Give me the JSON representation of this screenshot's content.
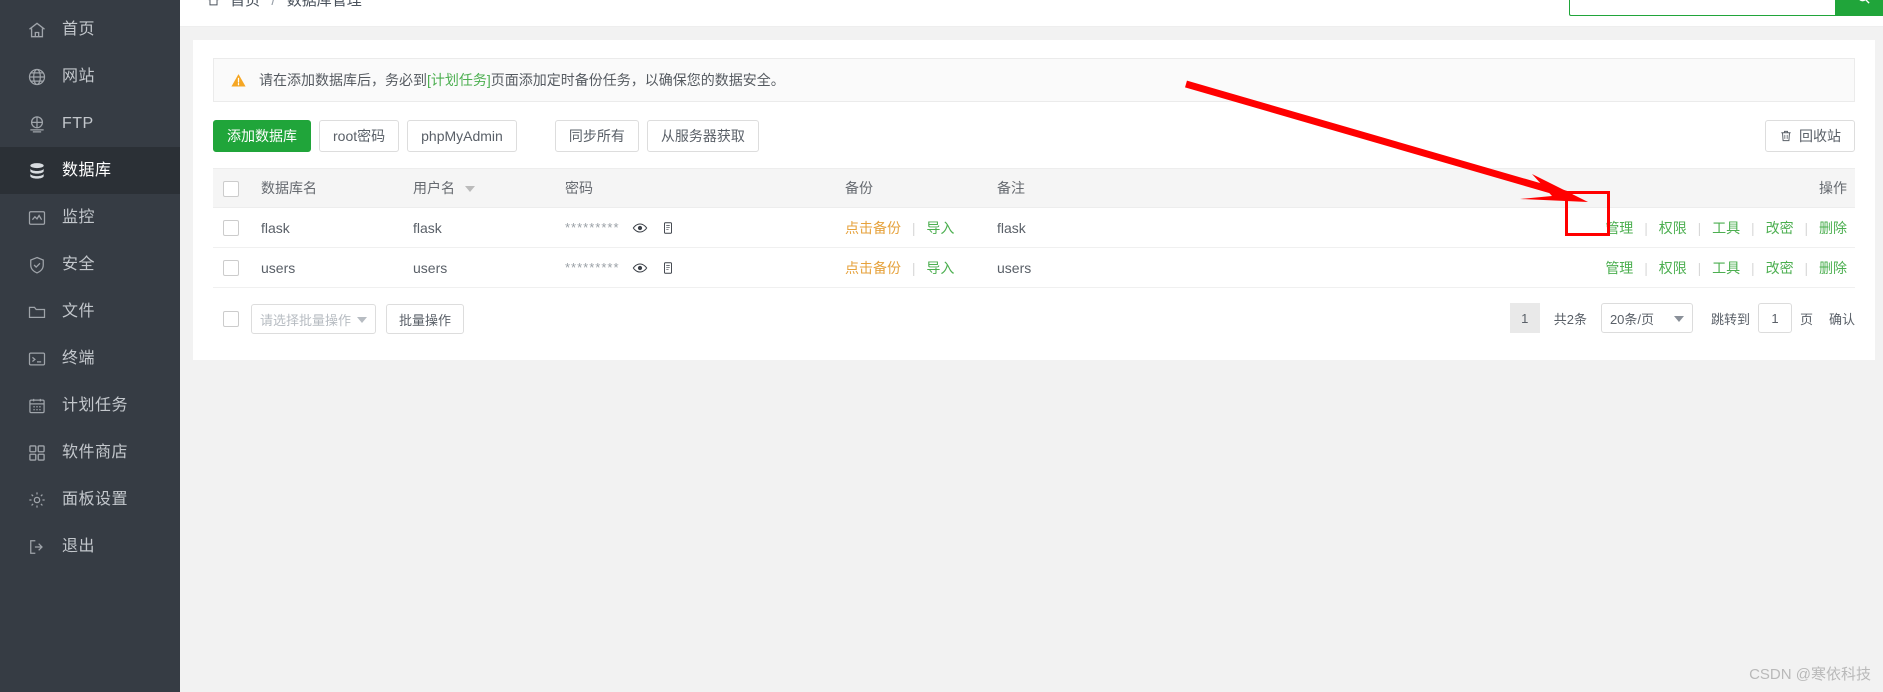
{
  "sidebar": {
    "items": [
      {
        "label": "首页",
        "icon": "home-icon",
        "active": false
      },
      {
        "label": "网站",
        "icon": "globe-icon",
        "active": false
      },
      {
        "label": "FTP",
        "icon": "ftp-icon",
        "active": false
      },
      {
        "label": "数据库",
        "icon": "database-icon",
        "active": true
      },
      {
        "label": "监控",
        "icon": "monitor-icon",
        "active": false
      },
      {
        "label": "安全",
        "icon": "shield-icon",
        "active": false
      },
      {
        "label": "文件",
        "icon": "folder-icon",
        "active": false
      },
      {
        "label": "终端",
        "icon": "terminal-icon",
        "active": false
      },
      {
        "label": "计划任务",
        "icon": "calendar-icon",
        "active": false
      },
      {
        "label": "软件商店",
        "icon": "apps-icon",
        "active": false
      },
      {
        "label": "面板设置",
        "icon": "gear-icon",
        "active": false
      },
      {
        "label": "退出",
        "icon": "logout-icon",
        "active": false
      }
    ]
  },
  "topbar": {
    "breadcrumb_home": "首页",
    "breadcrumb_sep": "/",
    "breadcrumb_current": "数据库管理",
    "search_value": "",
    "search_placeholder": "",
    "search_button_icon": "search-icon"
  },
  "notice": {
    "icon": "warning-icon",
    "text_before": "请在添加数据库后，务必到",
    "link": "[计划任务]",
    "text_after": "页面添加定时备份任务，以确保您的数据安全。"
  },
  "toolbar": {
    "add_db": "添加数据库",
    "root_password": "root密码",
    "phpmyadmin": "phpMyAdmin",
    "sync_all": "同步所有",
    "fetch_from_server": "从服务器获取",
    "recycle_bin": "回收站",
    "recycle_icon": "trash-icon"
  },
  "table": {
    "columns": {
      "checkbox": "",
      "db_name": "数据库名",
      "user_name": "用户名",
      "password": "密码",
      "backup": "备份",
      "remark": "备注",
      "action": "操作"
    },
    "sort_column": "用户名",
    "sort_icon": "chevron-down-icon",
    "rows": [
      {
        "db_name": "flask",
        "user_name": "flask",
        "password_mask": "*********",
        "eye_icon": "eye-icon",
        "copy_icon": "copy-icon",
        "backup_action": "点击备份",
        "import_action": "导入",
        "remark": "flask",
        "actions": [
          "管理",
          "权限",
          "工具",
          "改密",
          "删除"
        ]
      },
      {
        "db_name": "users",
        "user_name": "users",
        "password_mask": "*********",
        "eye_icon": "eye-icon",
        "copy_icon": "copy-icon",
        "backup_action": "点击备份",
        "import_action": "导入",
        "remark": "users",
        "actions": [
          "管理",
          "权限",
          "工具",
          "改密",
          "删除"
        ]
      }
    ]
  },
  "footer": {
    "batch_select_placeholder": "请选择批量操作",
    "batch_button": "批量操作",
    "page_current": "1",
    "total_text": "共2条",
    "page_size": "20条/页",
    "jump_label": "跳转到",
    "jump_value": "1",
    "page_unit": "页",
    "confirm": "确认"
  },
  "annotations": {
    "highlight_target": "权限",
    "arrow_color": "#ff0000",
    "box_color": "#ff0000"
  },
  "watermark": "CSDN @寒依科技",
  "colors": {
    "sidebar_bg": "#363c44",
    "sidebar_active": "#2b3036",
    "primary_green": "#20a53a",
    "link_green": "#4caf50",
    "link_orange": "#e6a23c",
    "page_bg": "#f2f2f2"
  }
}
